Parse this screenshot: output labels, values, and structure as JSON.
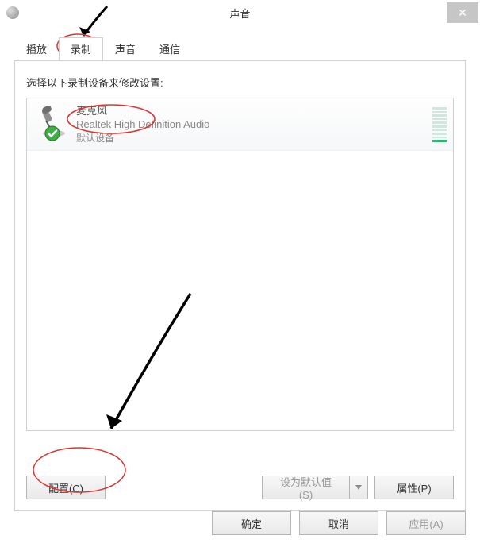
{
  "title": "声音",
  "close_glyph": "✕",
  "tabs": [
    "播放",
    "录制",
    "声音",
    "通信"
  ],
  "active_tab_index": 1,
  "instruction": "选择以下录制设备来修改设置:",
  "devices": [
    {
      "name": "麦克风",
      "driver": "Realtek High Definition Audio",
      "status": "默认设备",
      "level_bars_total": 10,
      "level_bars_active": 1,
      "is_default": true
    }
  ],
  "buttons": {
    "configure": "配置(C)",
    "set_default": "设为默认值(S)",
    "properties": "属性(P)",
    "ok": "确定",
    "cancel": "取消",
    "apply": "应用(A)"
  }
}
